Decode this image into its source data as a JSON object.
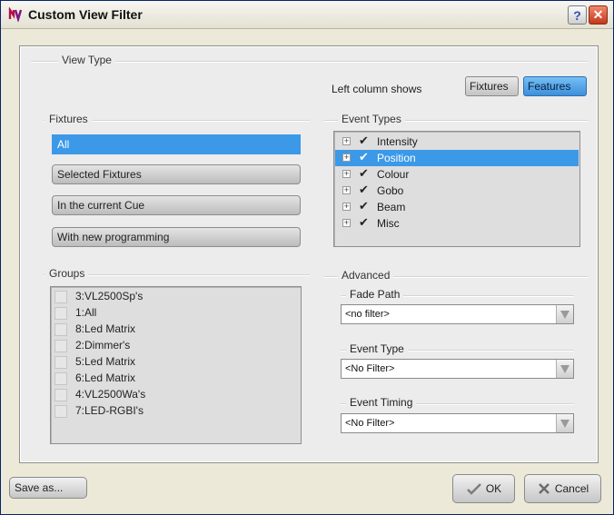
{
  "window": {
    "title": "Custom View Filter",
    "help_label": "?",
    "close_label": "✕"
  },
  "view_type": {
    "label": "View Type",
    "left_column_label": "Left column shows",
    "options": [
      "Fixtures",
      "Features"
    ],
    "selected": "Features"
  },
  "fixtures": {
    "label": "Fixtures",
    "items": [
      "All",
      "Selected Fixtures",
      "In the current Cue",
      "With new programming"
    ],
    "selected": "All"
  },
  "event_types": {
    "label": "Event Types",
    "items": [
      {
        "label": "Intensity",
        "checked": true
      },
      {
        "label": "Position",
        "checked": true,
        "selected": true
      },
      {
        "label": "Colour",
        "checked": true
      },
      {
        "label": "Gobo",
        "checked": true
      },
      {
        "label": "Beam",
        "checked": true
      },
      {
        "label": "Misc",
        "checked": true
      }
    ]
  },
  "groups": {
    "label": "Groups",
    "items": [
      "3:VL2500Sp's",
      "1:All",
      "8:Led Matrix",
      "2:Dimmer's",
      "5:Led Matrix",
      "6:Led Matrix",
      "4:VL2500Wa's",
      "7:LED-RGBI's"
    ]
  },
  "advanced": {
    "label": "Advanced",
    "fade_path": {
      "label": "Fade Path",
      "value": "<no filter>"
    },
    "event_type": {
      "label": "Event Type",
      "value": "<No Filter>"
    },
    "event_timing": {
      "label": "Event Timing",
      "value": "<No Filter>"
    }
  },
  "buttons": {
    "save_as": "Save as...",
    "ok": "OK",
    "cancel": "Cancel"
  },
  "icons": {
    "expand": "plus-expander-icon",
    "check": "checkmark-icon"
  }
}
